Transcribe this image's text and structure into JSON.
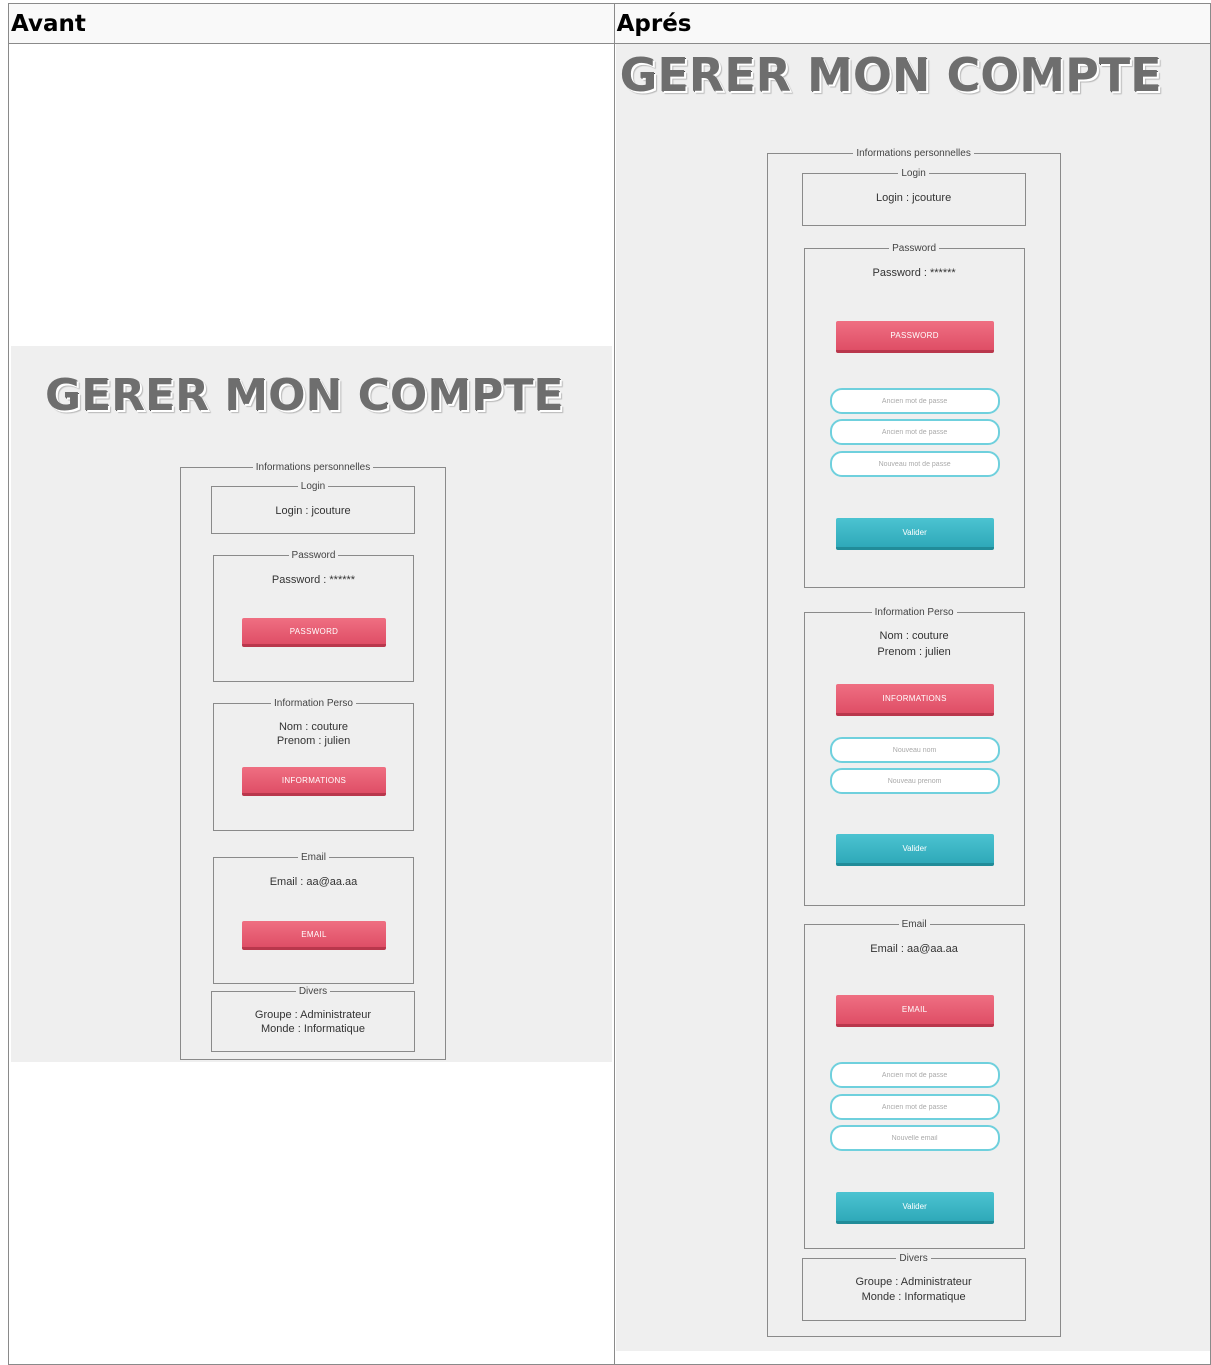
{
  "headers": {
    "before": "Avant",
    "after": "Aprés"
  },
  "before": {
    "title": "GERER MON COMPTE",
    "section_label": "Informations personnelles",
    "login": {
      "legend": "Login",
      "text": "Login : jcouture"
    },
    "password": {
      "legend": "Password",
      "text": "Password : ******",
      "button": "PASSWORD"
    },
    "perso": {
      "legend": "Information Perso",
      "nom": "Nom : couture",
      "prenom": "Prenom : julien",
      "button": "INFORMATIONS"
    },
    "email": {
      "legend": "Email",
      "text": "Email : aa@aa.aa",
      "button": "EMAIL"
    },
    "divers": {
      "legend": "Divers",
      "groupe": "Groupe : Administrateur",
      "monde": "Monde : Informatique"
    }
  },
  "after": {
    "title": "GERER MON COMPTE",
    "section_label": "Informations personnelles",
    "login": {
      "legend": "Login",
      "text": "Login : jcouture"
    },
    "password": {
      "legend": "Password",
      "text": "Password : ******",
      "button": "PASSWORD",
      "inputs": [
        "Ancien mot de passe",
        "Ancien mot de passe",
        "Nouveau mot de passe"
      ],
      "submit": "Valider"
    },
    "perso": {
      "legend": "Information Perso",
      "nom": "Nom : couture",
      "prenom": "Prenom : julien",
      "button": "INFORMATIONS",
      "inputs": [
        "Nouveau nom",
        "Nouveau prenom"
      ],
      "submit": "Valider"
    },
    "email": {
      "legend": "Email",
      "text": "Email : aa@aa.aa",
      "button": "EMAIL",
      "inputs": [
        "Ancien mot de passe",
        "Ancien mot de passe",
        "Nouvelle email"
      ],
      "submit": "Valider"
    },
    "divers": {
      "legend": "Divers",
      "groupe": "Groupe : Administrateur",
      "monde": "Monde : Informatique"
    }
  }
}
